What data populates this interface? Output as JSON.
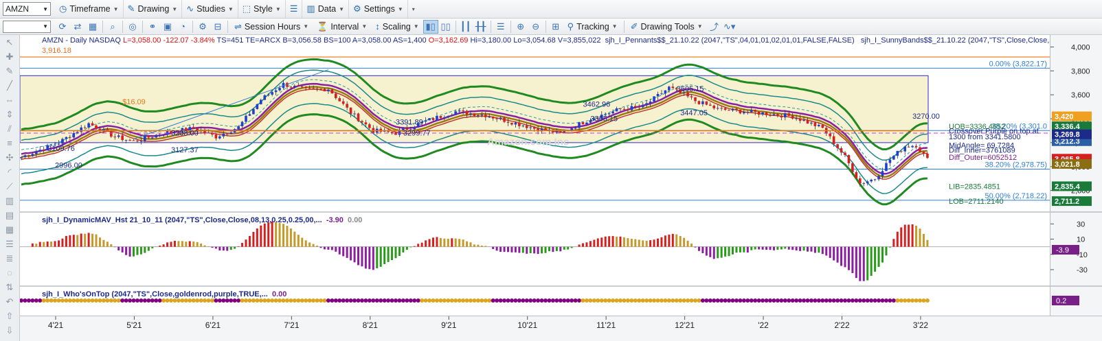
{
  "toolbar1": {
    "symbol": "AMZN",
    "items": [
      {
        "label": "Timeframe",
        "icon": "clock-icon"
      },
      {
        "label": "Drawing",
        "icon": "pencil-icon"
      },
      {
        "label": "Studies",
        "icon": "studies-icon"
      },
      {
        "label": "Style",
        "icon": "style-icon"
      },
      {
        "label": "Data",
        "icon": "data-icon"
      },
      {
        "label": "Settings",
        "icon": "gear-icon"
      }
    ]
  },
  "toolbar2": {
    "session_hours": "Session Hours",
    "interval": "Interval",
    "scaling": "Scaling",
    "tracking": "Tracking",
    "drawing_tools": "Drawing Tools"
  },
  "legend": {
    "symbol": "AMZN - Daily",
    "exchange": "NASDAQ",
    "last": "L=3,058.00",
    "change": "-122.07",
    "change_pct": "-3.84%",
    "ts": "TS=451",
    "te": "TE=ARCX",
    "bid": "B=3,056.58",
    "bid_size": "BS=100",
    "ask": "A=3,058.00",
    "ask_size": "AS=1,400",
    "open": "O=3,162.69",
    "high": "Hi=3,180.00",
    "low": "Lo=3,054.68",
    "volume": "V=3,855,022",
    "study1": "sjh_I_Pennants$$_21.10.22 (2047,\"TS\",04,01,01,02,01,01,FALSE,FALSE)",
    "study2": "sjh_I_SunnyBands$$_21.10.22 (2047,\"TS\",Close,Close,...",
    "high_marker": "3,916.18",
    "watermark": "Amazon.com Inc"
  },
  "subpanels": {
    "mav_title": "sjh_I_DynamicMAV_Hst 21_10_11 (2047,\"TS\",Close,Close,08,13,0.25,0.25,00,...",
    "mav_value": "-3.90",
    "mav_value2": "0.00",
    "whos_title": "sjh_I_Who'sOnTop (2047,\"TS\",Close,goldenrod,purple,TRUE,...",
    "whos_value": "0.00"
  },
  "chart_data": [
    {
      "type": "candlestick",
      "title": "AMZN - Daily NASDAQ",
      "ylim": [
        2620,
        4100
      ],
      "y_ticks": [
        "4,000",
        "3,800",
        "3,600",
        "3,400",
        "3,200",
        "3,000",
        "2,800"
      ],
      "x_ticks": [
        "4'21",
        "5'21",
        "6'21",
        "7'21",
        "8'21",
        "9'21",
        "10'21",
        "11'21",
        "12'21",
        "'22",
        "2'22",
        "3'22"
      ],
      "price_path": [
        [
          0,
          3080
        ],
        [
          10,
          3200
        ],
        [
          18,
          3360
        ],
        [
          25,
          3250
        ],
        [
          30,
          3210
        ],
        [
          38,
          3280
        ],
        [
          46,
          3320
        ],
        [
          52,
          3250
        ],
        [
          58,
          3330
        ],
        [
          64,
          3560
        ],
        [
          70,
          3690
        ],
        [
          76,
          3640
        ],
        [
          82,
          3650
        ],
        [
          88,
          3450
        ],
        [
          94,
          3300
        ],
        [
          100,
          3280
        ],
        [
          108,
          3380
        ],
        [
          116,
          3460
        ],
        [
          124,
          3430
        ],
        [
          130,
          3380
        ],
        [
          137,
          3320
        ],
        [
          144,
          3280
        ],
        [
          152,
          3400
        ],
        [
          160,
          3480
        ],
        [
          166,
          3500
        ],
        [
          173,
          3660
        ],
        [
          180,
          3550
        ],
        [
          186,
          3480
        ],
        [
          193,
          3460
        ],
        [
          200,
          3440
        ],
        [
          206,
          3420
        ],
        [
          214,
          3320
        ],
        [
          220,
          3080
        ],
        [
          224,
          2860
        ],
        [
          228,
          2900
        ],
        [
          232,
          3060
        ],
        [
          236,
          3170
        ],
        [
          239,
          3180
        ],
        [
          242,
          3058
        ]
      ],
      "horizontal_levels": [
        {
          "label": "0.00% (3,822.17)",
          "value": 3822.17,
          "color": "#2f7fd6"
        },
        {
          "label": "38.20% (3,301.0",
          "value": 3301.0,
          "color": "#2f7fd6"
        },
        {
          "label": "50.00% (2,718.22)",
          "value": 2718.22,
          "color": "#2f7fd6"
        },
        {
          "label": "38.20% (2,978.75)",
          "value": 2978.75,
          "color": "#2f7fd6"
        }
      ],
      "price_labels": [
        {
          "text": "$16.09",
          "color": "#e07b17"
        },
        {
          "text": "3109.76",
          "color": "#1c2a8a"
        },
        {
          "text": "2996.00",
          "color": "#1c2a8a"
        },
        {
          "text": "3208.00",
          "color": "#1c2a8a"
        },
        {
          "text": "3127.37",
          "color": "#1c2a8a"
        },
        {
          "text": "3391.89",
          "color": "#1c2a8a"
        },
        {
          "text": "3299.77",
          "color": "#1c2a8a"
        },
        {
          "text": "3462.96",
          "color": "#1c2a8a"
        },
        {
          "text": "3365.15",
          "color": "#1c2a8a"
        },
        {
          "text": "3447.05",
          "color": "#1c2a8a"
        },
        {
          "text": "3605.15",
          "color": "#1c2a8a"
        },
        {
          "text": "3270.00",
          "color": "#1c2a8a"
        }
      ],
      "band_labels": [
        {
          "text": "UOB=3336.4652",
          "color": "#1a7a3a"
        },
        {
          "text": "Crossover Purple on top at",
          "color": "#1c2a8a"
        },
        {
          "text": "1300 from 3341.5800",
          "color": "#1c2a8a"
        },
        {
          "text": "MidAngle= 69.7284",
          "color": "#1c2a8a"
        },
        {
          "text": "Diff_Inner=3761089",
          "color": "#1c2a8a"
        },
        {
          "text": "Diff_Outer=6052512",
          "color": "#7a1f8a"
        },
        {
          "text": "LIB=2835.4851",
          "color": "#1a7a3a"
        },
        {
          "text": "LOB=2711.2140",
          "color": "#1a7a3a"
        }
      ],
      "axis_markers": [
        {
          "text": "3,336.4",
          "bg": "#1a7a3a",
          "value": 3336.4
        },
        {
          "text": "3,212.3",
          "bg": "#2b5ea7",
          "value": 3212.3
        },
        {
          "text": "3,065.8",
          "bg": "#d61f1f",
          "value": 3065.8
        },
        {
          "text": "3,021.8",
          "bg": "#8b6d12",
          "value": 3021.8
        },
        {
          "text": "2,835.4",
          "bg": "#1a7a3a",
          "value": 2835.4
        },
        {
          "text": "2,711.2",
          "bg": "#1a7a3a",
          "value": 2711.2
        },
        {
          "text": "3,420",
          "bg": "#f0a020",
          "value": 3420
        },
        {
          "text": "3,269.8",
          "bg": "#1c2a8a",
          "value": 3269.8
        }
      ]
    },
    {
      "type": "bar",
      "title": "sjh_I_DynamicMAV_Hst",
      "ylim": [
        -48,
        42
      ],
      "y_ticks": [
        "30",
        "10",
        "-10",
        "-30"
      ],
      "last_value": "-3.9"
    },
    {
      "type": "dots",
      "title": "sjh_I_Who'sOnTop",
      "colors": {
        "golden": "goldenrod",
        "purple": "purple"
      },
      "last_value": "0.2"
    }
  ]
}
